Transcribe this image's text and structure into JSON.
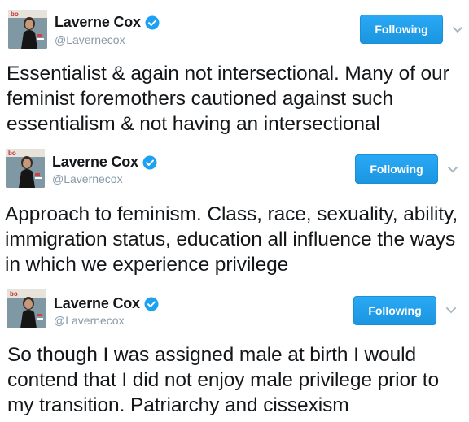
{
  "tweets": [
    {
      "name": "Laverne Cox",
      "handle": "@Lavernecox",
      "follow_label": "Following",
      "text": "Essentialist & again not intersectional. Many of our feminist foremothers cautioned against such essentialism & not having an intersectional"
    },
    {
      "name": "Laverne Cox",
      "handle": "@Lavernecox",
      "follow_label": "Following",
      "text": "Approach to feminism. Class, race, sexuality, ability, immigration status, education all influence the ways in which we experience privilege"
    },
    {
      "name": "Laverne Cox",
      "handle": "@Lavernecox",
      "follow_label": "Following",
      "text": "So though I was assigned male at birth I would contend that I did not enjoy male privilege prior to my transition. Patriarchy and cissexism"
    }
  ],
  "icons": {
    "verified": "verified-badge-icon",
    "chevron": "chevron-down-icon",
    "avatar": "profile-avatar"
  },
  "colors": {
    "follow_button": "#1da1f2",
    "verified": "#1da1f2",
    "handle_text": "#8899a6",
    "body_text": "#14171a"
  }
}
